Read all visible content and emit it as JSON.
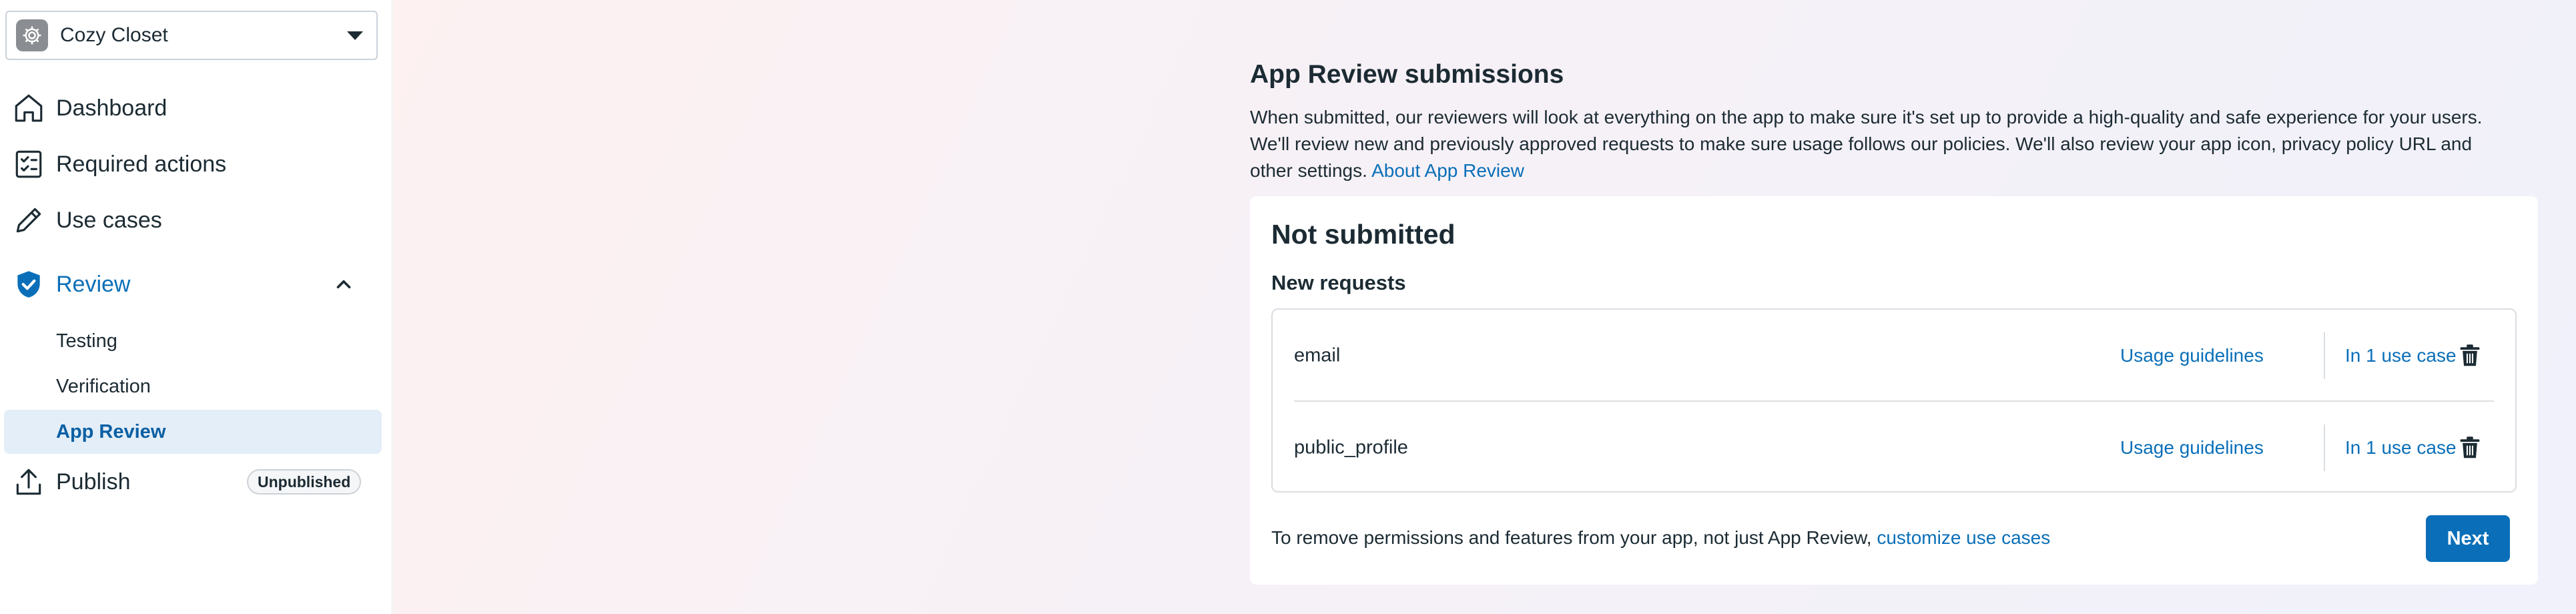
{
  "app_selector": {
    "name": "Cozy Closet",
    "icon": "gear-icon"
  },
  "sidebar": {
    "items": [
      {
        "label": "Dashboard",
        "icon": "home-icon"
      },
      {
        "label": "Required actions",
        "icon": "checklist-icon"
      },
      {
        "label": "Use cases",
        "icon": "pencil-icon"
      },
      {
        "label": "Review",
        "icon": "shield-check-icon",
        "expanded": true
      },
      {
        "label": "Publish",
        "icon": "upload-icon",
        "badge": "Unpublished"
      }
    ],
    "review_subitems": [
      {
        "label": "Testing"
      },
      {
        "label": "Verification"
      },
      {
        "label": "App Review",
        "selected": true
      }
    ]
  },
  "main": {
    "title": "App Review submissions",
    "description_line1": "When submitted, our reviewers will look at everything on the app to make sure it's set up to provide a high-quality and safe experience for your users.",
    "description_line2": "We'll review new and previously approved requests to make sure usage follows our policies. We'll also review your app icon, privacy policy URL and",
    "description_line3": "other settings.",
    "about_link": "About App Review",
    "card": {
      "status_title": "Not submitted",
      "section_title": "New requests",
      "requests": [
        {
          "permission": "email",
          "usage_link": "Usage guidelines",
          "use_case_link": "In 1 use case"
        },
        {
          "permission": "public_profile",
          "usage_link": "Usage guidelines",
          "use_case_link": "In 1 use case"
        }
      ],
      "footer_text": "To remove permissions and features from your app, not just App Review,",
      "footer_link": "customize use cases",
      "next_button": "Next"
    }
  },
  "colors": {
    "accent": "#0a6fb8",
    "selected_bg": "#e3eef8",
    "text": "#1c2b33",
    "border": "#dadde1"
  }
}
